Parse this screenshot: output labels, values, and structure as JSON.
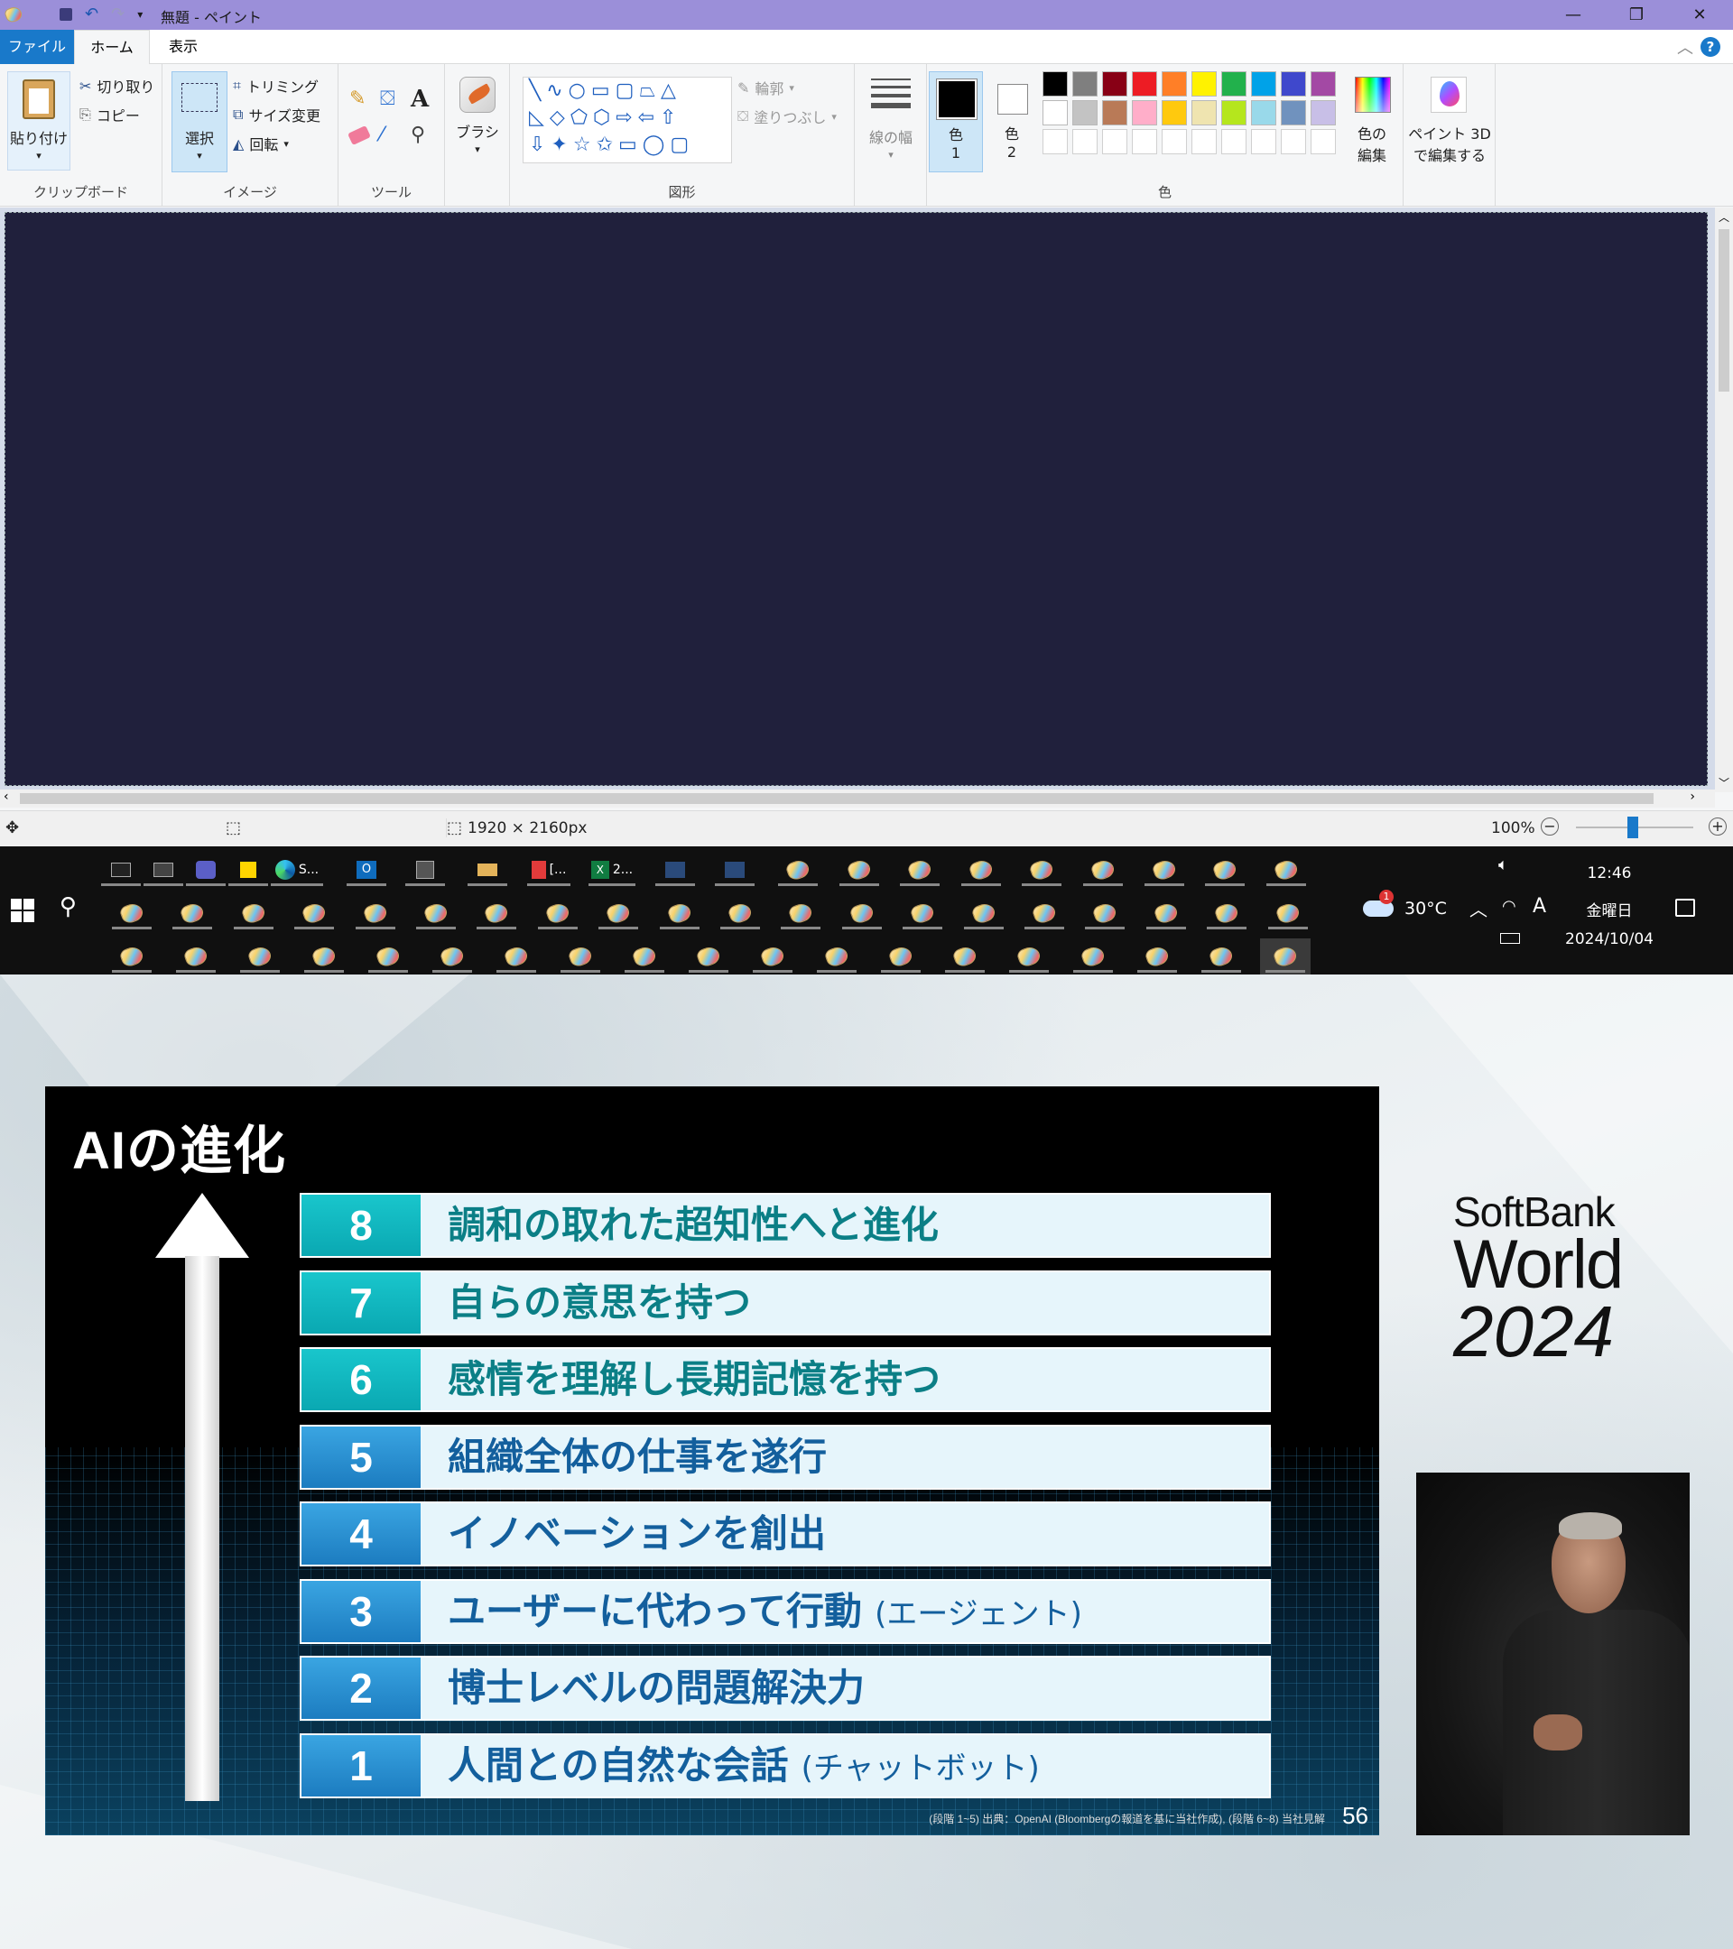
{
  "paint": {
    "title": "無題 - ペイント",
    "window_controls": {
      "minimize": "—",
      "restore": "❐",
      "close": "✕"
    },
    "tabs": [
      "ファイル",
      "ホーム",
      "表示"
    ],
    "ribbon": {
      "clipboard": {
        "paste": "貼り付け",
        "cut": "切り取り",
        "copy": "コピー",
        "label": "クリップボード"
      },
      "image": {
        "select": "選択",
        "crop": "トリミング",
        "resize": "サイズ変更",
        "rotate": "回転",
        "label": "イメージ"
      },
      "tools": {
        "label": "ツール"
      },
      "brush": {
        "label": "ブラシ"
      },
      "shapes": {
        "outline": "輪郭",
        "fill": "塗りつぶし",
        "label": "図形"
      },
      "size": {
        "label": "線の幅"
      },
      "colors": {
        "color1_a": "色",
        "color1_b": "1",
        "color2_a": "色",
        "color2_b": "2",
        "edit_a": "色の",
        "edit_b": "編集",
        "label": "色"
      },
      "paint3d": {
        "line1": "ペイント 3D",
        "line2": "で編集する"
      }
    },
    "palette_row1": [
      "#000000",
      "#7f7f7f",
      "#880015",
      "#ed1c24",
      "#ff7f27",
      "#fff200",
      "#22b14c",
      "#00a2e8",
      "#3f48cc",
      "#a349a4"
    ],
    "palette_row2": [
      "#ffffff",
      "#c3c3c3",
      "#b97a57",
      "#ffaec9",
      "#ffc90e",
      "#efe4b0",
      "#b5e61d",
      "#99d9ea",
      "#7092be",
      "#c8bfe7"
    ],
    "canvas_color": "#20203c",
    "status": {
      "dimensions": "1920 × 2160px",
      "zoom": "100%"
    }
  },
  "taskbar": {
    "apps": [
      {
        "label": "S..."
      },
      {
        "label": "[..."
      },
      {
        "label": "2..."
      }
    ],
    "weather": "30°C",
    "weather_badge": "1",
    "time": "12:46",
    "day": "金曜日",
    "date": "2024/10/04"
  },
  "slide": {
    "title": "AIの進化",
    "levels": [
      {
        "num": "8",
        "text": "調和の取れた超知性へと進化",
        "note": ""
      },
      {
        "num": "7",
        "text": "自らの意思を持つ",
        "note": ""
      },
      {
        "num": "6",
        "text": "感情を理解し長期記憶を持つ",
        "note": ""
      },
      {
        "num": "5",
        "text": "組織全体の仕事を遂行",
        "note": ""
      },
      {
        "num": "4",
        "text": "イノベーションを創出",
        "note": ""
      },
      {
        "num": "3",
        "text": "ユーザーに代わって行動",
        "note": "(エージェント)"
      },
      {
        "num": "2",
        "text": "博士レベルの問題解決力",
        "note": ""
      },
      {
        "num": "1",
        "text": "人間との自然な会話",
        "note": "(チャットボット)"
      }
    ],
    "footnote": "(段階 1~5) 出典：OpenAI (Bloombergの報道を基に当社作成), (段階 6~8) 当社見解",
    "page": "56"
  },
  "logo": {
    "line1": "SoftBank",
    "line2": "World",
    "line3": "2024"
  }
}
